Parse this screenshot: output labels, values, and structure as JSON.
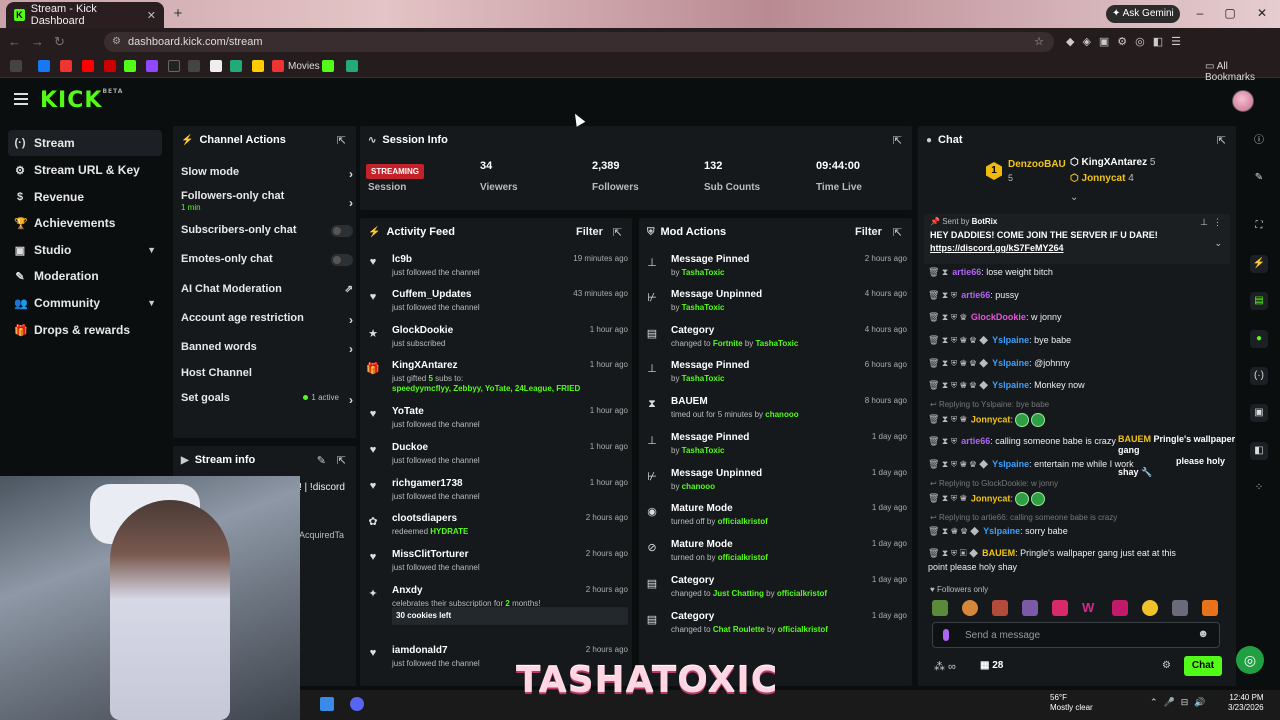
{
  "browser": {
    "tab_title": "Stream - Kick Dashboard",
    "url": "dashboard.kick.com/stream",
    "ask_gemini": "Ask Gemini",
    "bookmark_movies": "Movies",
    "all_bookmarks": "All Bookmarks"
  },
  "header": {
    "logo": "KICK",
    "logo_badge": "BETA"
  },
  "nav": [
    {
      "label": "Stream",
      "icon": "(·)"
    },
    {
      "label": "Stream URL & Key",
      "icon": "⚙"
    },
    {
      "label": "Revenue",
      "icon": "$"
    },
    {
      "label": "Achievements",
      "icon": "🏆"
    },
    {
      "label": "Studio",
      "icon": "▣"
    },
    {
      "label": "Moderation",
      "icon": "✎"
    },
    {
      "label": "Community",
      "icon": "👥"
    },
    {
      "label": "Drops & rewards",
      "icon": "🎁"
    }
  ],
  "channel_actions": {
    "title": "Channel Actions",
    "slow_mode": "Slow mode",
    "followers_only": "Followers-only chat",
    "followers_only_sub": "1 min",
    "subscribers_only": "Subscribers-only chat",
    "emotes_only": "Emotes-only chat",
    "ai_moderation": "AI Chat Moderation",
    "account_age": "Account age restriction",
    "banned_words": "Banned words",
    "host_channel": "Host Channel",
    "set_goals": "Set goals",
    "set_goals_status": "1 active"
  },
  "stream_info": {
    "title": "Stream info",
    "title_fragment": "! | !discord",
    "category_fragment": "AcquiredTa"
  },
  "session": {
    "title": "Session Info",
    "badge": "STREAMING",
    "session_label": "Session",
    "viewers": "34",
    "viewers_label": "Viewers",
    "followers": "2,389",
    "followers_label": "Followers",
    "subs": "132",
    "subs_label": "Sub Counts",
    "time": "09:44:00",
    "time_label": "Time Live"
  },
  "activity": {
    "title": "Activity Feed",
    "filter": "Filter",
    "items": [
      {
        "name": "lc9b",
        "desc": "just followed the channel",
        "time": "19 minutes ago",
        "icon": "♥"
      },
      {
        "name": "Cuffem_Updates",
        "desc": "just followed the channel",
        "time": "43 minutes ago",
        "icon": "♥"
      },
      {
        "name": "GlockDookie",
        "desc": "just subscribed",
        "time": "1 hour ago",
        "icon": "★"
      },
      {
        "name": "KingXAntarez",
        "desc": "just gifted ",
        "desc_count": "5",
        "desc_mid": " subs to:",
        "desc_list": "speedyymcflyy, Zebbyy, YoTate, 24League, FRIED",
        "time": "1 hour ago",
        "icon": "🎁"
      },
      {
        "name": "YoTate",
        "desc": "just followed the channel",
        "time": "1 hour ago",
        "icon": "♥"
      },
      {
        "name": "Duckoe",
        "desc": "just followed the channel",
        "time": "1 hour ago",
        "icon": "♥"
      },
      {
        "name": "richgamer1738",
        "desc": "just followed the channel",
        "time": "1 hour ago",
        "icon": "♥"
      },
      {
        "name": "clootsdiapers",
        "desc": "redeemed ",
        "desc_hl": "HYDRATE",
        "time": "2 hours ago",
        "icon": "✿"
      },
      {
        "name": "MissClitTorturer",
        "desc": "just followed the channel",
        "time": "2 hours ago",
        "icon": "♥"
      },
      {
        "name": "Anxdy",
        "desc": "celebrates their subscription for ",
        "desc_hl": "2",
        "desc_tail": " months!",
        "cookies": "30 cookies left",
        "time": "2 hours ago",
        "icon": "✦"
      },
      {
        "name": "iamdonald7",
        "desc": "just followed the channel",
        "time": "2 hours ago",
        "icon": "♥"
      }
    ]
  },
  "mod": {
    "title": "Mod Actions",
    "filter": "Filter",
    "items": [
      {
        "name": "Message Pinned",
        "pre": "by ",
        "hl": "TashaToxic",
        "time": "2 hours ago",
        "icon": "📌"
      },
      {
        "name": "Message Unpinned",
        "pre": "by ",
        "hl": "TashaToxic",
        "time": "4 hours ago",
        "icon": "✂"
      },
      {
        "name": "Category",
        "pre": "changed to ",
        "hl": "Fortnite",
        "mid": " by ",
        "hl2": "TashaToxic",
        "time": "4 hours ago",
        "icon": "▤"
      },
      {
        "name": "Message Pinned",
        "pre": "by ",
        "hl": "TashaToxic",
        "time": "6 hours ago",
        "icon": "📌"
      },
      {
        "name": "BAUEM",
        "pre": "timed out for 5 minutes by ",
        "hl": "chanooo",
        "time": "8 hours ago",
        "icon": "⧗"
      },
      {
        "name": "Message Pinned",
        "pre": "by ",
        "hl": "TashaToxic",
        "time": "1 day ago",
        "icon": "📌"
      },
      {
        "name": "Message Unpinned",
        "pre": "by ",
        "hl": "chanooo",
        "time": "1 day ago",
        "icon": "✂"
      },
      {
        "name": "Mature Mode",
        "pre": "turned off by ",
        "hl": "officialkristof",
        "time": "1 day ago",
        "icon": "◉"
      },
      {
        "name": "Mature Mode",
        "pre": "turned on by ",
        "hl": "officialkristof",
        "time": "1 day ago",
        "icon": "⊘"
      },
      {
        "name": "Category",
        "pre": "changed to ",
        "hl": "Just Chatting",
        "mid": " by ",
        "hl2": "officialkristof",
        "time": "1 day ago",
        "icon": "▤"
      },
      {
        "name": "Category",
        "pre": "changed to ",
        "hl": "Chat Roulette",
        "mid": " by ",
        "hl2": "officialkristof",
        "time": "1 day ago",
        "icon": "▤"
      }
    ]
  },
  "chat": {
    "title": "Chat",
    "top_gifter": "DenzooBAU",
    "top_gifter_count": "5",
    "gifter2": "KingXAntarez",
    "gifter2_count": "5",
    "gifter3": "Jonnycat",
    "gifter3_count": "4",
    "pinned_sent_by": "Sent by",
    "pinned_user": "BotRix",
    "pinned_text": "HEY DADDIES! COME JOIN THE SERVER IF U DARE!",
    "pinned_link": "https://discord.gg/kS7FeMY264",
    "messages": [
      {
        "user": "artie66",
        "color": "#b065f0",
        "text": ": lose weight bitch"
      },
      {
        "user": "artie66",
        "color": "#b065f0",
        "text": ": pussy"
      },
      {
        "user": "GlockDookie",
        "color": "#e455d8",
        "text": ": w jonny"
      },
      {
        "user": "Yslpaine",
        "color": "#3aa0ff",
        "text": ": bye babe"
      },
      {
        "user": "Yslpaine",
        "color": "#3aa0ff",
        "text": ": @johnny"
      },
      {
        "user": "Yslpaine",
        "color": "#3aa0ff",
        "text": ": Monkey now"
      },
      {
        "reply": "Replying to Yslpaine: bye babe"
      },
      {
        "user": "Jonnycat",
        "color": "#f0c419",
        "text": ":"
      },
      {
        "user": "artie66",
        "color": "#b065f0",
        "text": ": calling someone babe is crazy"
      },
      {
        "user": "Yslpaine",
        "color": "#3aa0ff",
        "text": ": entertain me while I work"
      },
      {
        "reply": "Replying to GlockDookie: w jonny"
      },
      {
        "user": "Jonnycat",
        "color": "#f0c419",
        "text": ":"
      },
      {
        "reply": "Replying to artie66: calling someone babe is crazy"
      },
      {
        "user": "Yslpaine",
        "color": "#3aa0ff",
        "text": ": sorry babe"
      },
      {
        "user": "BAUEM",
        "color": "#f0c419",
        "text": ": Pringle's wallpaper gang just eat at this"
      },
      {
        "cont": "point please holy shay"
      }
    ],
    "overlay_user": "BAUEM",
    "overlay_text": "Pringle's wallpaper gang",
    "overlay_text2": "please holy shay",
    "followers_only": "Followers only",
    "input_placeholder": "Send a message",
    "points": "28",
    "chat_button": "Chat"
  },
  "overlay": {
    "watermark": "TASHATOXIC"
  },
  "taskbar": {
    "temp": "56°F",
    "weather": "Mostly clear",
    "time": "12:40 PM",
    "date": "3/23/2026"
  },
  "colors": {
    "kick_green": "#53fc18",
    "panel": "#15191c",
    "bg": "#0b0e0f",
    "streaming_red": "#c3222a"
  }
}
